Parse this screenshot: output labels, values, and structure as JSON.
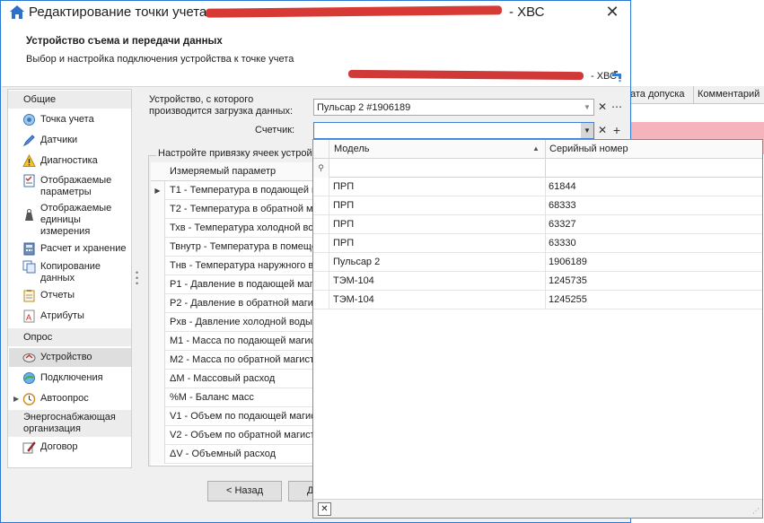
{
  "window": {
    "title": "Редактирование точки учета",
    "title_suffix": "- ХВС"
  },
  "header": {
    "title": "Устройство съема и передачи данных",
    "subtitle": "Выбор и настройка подключения устройства к точке учета",
    "point_suffix": "- ХВС"
  },
  "nav": {
    "groups": [
      "Общие",
      "Опрос",
      "Энергоснабжающая организация"
    ],
    "items": [
      {
        "label": "Точка учета",
        "icon": "location-icon"
      },
      {
        "label": "Датчики",
        "icon": "pen-icon"
      },
      {
        "label": "Диагностика",
        "icon": "warning-icon"
      },
      {
        "label": "Отображаемые параметры",
        "icon": "checklist-icon"
      },
      {
        "label": "Отображаемые единицы измерения",
        "icon": "weights-icon"
      },
      {
        "label": "Расчет и хранение",
        "icon": "calculator-icon"
      },
      {
        "label": "Копирование данных",
        "icon": "copy-icon"
      },
      {
        "label": "Отчеты",
        "icon": "report-icon"
      },
      {
        "label": "Атрибуты",
        "icon": "attribute-icon"
      },
      {
        "label": "Устройство",
        "icon": "device-icon"
      },
      {
        "label": "Подключения",
        "icon": "connection-icon"
      },
      {
        "label": "Автоопрос",
        "icon": "clock-icon"
      },
      {
        "label": "Договор",
        "icon": "contract-icon"
      }
    ]
  },
  "form": {
    "device_label": "Устройство, с которого производится загрузка данных:",
    "device_value": "Пульсар 2 #1906189",
    "counter_label": "Счетчик:",
    "counter_value": "",
    "binding_group_title": "Настройте привязку ячеек устрой"
  },
  "params_grid": {
    "header": "Измеряемый параметр",
    "rows": [
      "T1 - Температура в подающей м",
      "T2 - Температура в обратной ма",
      "Тхв - Температура холодной во",
      "Твнутр - Температура в помеще",
      "Тнв - Температура наружного в",
      "P1 - Давление в подающей магис",
      "P2 - Давление в обратной магис",
      "Рхв - Давление холодной воды",
      "M1 - Масса по подающей магист",
      "M2 - Масса по обратной магистр",
      "ΔM - Массовый расход",
      "%M - Баланс масс",
      "V1 - Объем по подающей магист",
      "V2 - Объем по обратной магистр",
      "ΔV - Объемный расход"
    ]
  },
  "buttons": {
    "back": "< Назад",
    "next": "Д"
  },
  "popup": {
    "col_model": "Модель",
    "col_serial": "Серийный номер",
    "rows": [
      {
        "model": "ПРП",
        "serial": "61844"
      },
      {
        "model": "ПРП",
        "serial": "68333"
      },
      {
        "model": "ПРП",
        "serial": "63327"
      },
      {
        "model": "ПРП",
        "serial": "63330"
      },
      {
        "model": "Пульсар 2",
        "serial": "1906189"
      },
      {
        "model": "ТЭМ-104",
        "serial": "1245735"
      },
      {
        "model": "ТЭМ-104",
        "serial": "1245255"
      }
    ]
  },
  "background_grid": {
    "col1": "ата допуска",
    "col2": "Комментарий"
  },
  "colors": {
    "accent_border": "#2b79d1",
    "redaction": "#d73a35",
    "highlight_row": "#f5b3bb",
    "selected_nav": "#dedede"
  }
}
